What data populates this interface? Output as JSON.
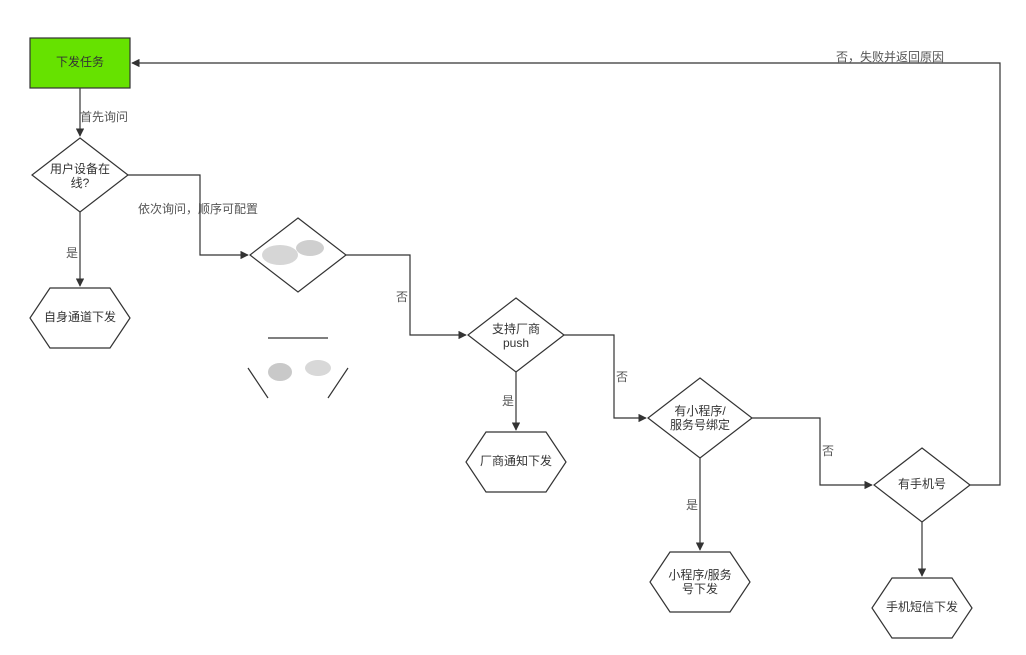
{
  "nodes": {
    "start": {
      "label": "下发任务"
    },
    "device_online": {
      "line1": "用户设备在",
      "line2": "线?"
    },
    "self_channel": {
      "label": "自身通道下发"
    },
    "vendor_push": {
      "line1": "支持厂商",
      "line2": "push"
    },
    "vendor_notify": {
      "label": "厂商通知下发"
    },
    "mp_bound": {
      "line1": "有小程序/",
      "line2": "服务号绑定"
    },
    "mp_send": {
      "line1": "小程序/服务",
      "line2": "号下发"
    },
    "has_phone": {
      "label": "有手机号"
    },
    "sms_send": {
      "label": "手机短信下发"
    }
  },
  "edges": {
    "first_ask": "首先询问",
    "yes": "是",
    "no": "否",
    "seq_ask": "依次询问，顺序可配置",
    "fail_return": "否，失败并返回原因"
  },
  "colors": {
    "start_fill": "#66e200",
    "stroke": "#333333"
  }
}
